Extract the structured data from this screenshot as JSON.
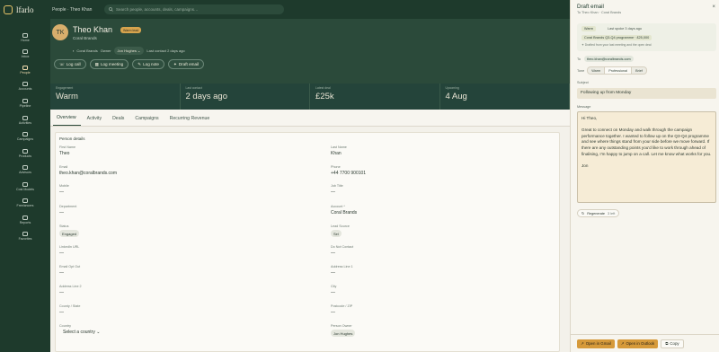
{
  "app": {
    "name": "lfarlo"
  },
  "breadcrumb": {
    "text": "People · Theo Khan"
  },
  "search": {
    "placeholder": "Search people, accounts, deals, campaigns…"
  },
  "sidebar": {
    "items": [
      {
        "label": "Home",
        "icon": "home-icon"
      },
      {
        "label": "Inbox",
        "icon": "inbox-icon"
      },
      {
        "label": "People",
        "icon": "people-icon",
        "active": true
      },
      {
        "label": "Accounts",
        "icon": "accounts-icon"
      },
      {
        "label": "Pipeline",
        "icon": "pipeline-icon"
      },
      {
        "label": "Activities",
        "icon": "activities-icon"
      },
      {
        "label": "Campaigns",
        "icon": "campaigns-icon"
      },
      {
        "label": "Products",
        "icon": "products-icon"
      },
      {
        "label": "Advisors",
        "icon": "advisors-icon"
      },
      {
        "label": "Cost Models",
        "icon": "cost-models-icon"
      },
      {
        "label": "Freelancers",
        "icon": "freelancers-icon"
      },
      {
        "label": "Reports",
        "icon": "reports-icon"
      },
      {
        "label": "Favorites",
        "icon": "favorites-icon"
      }
    ]
  },
  "contact": {
    "initials": "TK",
    "name": "Theo Khan",
    "badge": "Warm lead",
    "company": "Coral Brands",
    "meta_company": "Coral Brands",
    "owner_label": "Owner",
    "owner": "Jon Hughes",
    "last_contact": "Last contact 2 days ago"
  },
  "actions": [
    "Log call",
    "Log meeting",
    "Log note",
    "Draft email"
  ],
  "stats": [
    {
      "label": "Engagement",
      "value": "Warm"
    },
    {
      "label": "Last contact",
      "value": "2 days ago"
    },
    {
      "label": "Latest deal",
      "value": "£25k"
    },
    {
      "label": "Upcoming",
      "value": "4 Aug"
    }
  ],
  "tabs": [
    "Overview",
    "Activity",
    "Deals",
    "Campaigns",
    "Recurring Revenue"
  ],
  "details": {
    "title": "Person details",
    "fields": [
      {
        "label": "First Name",
        "value": "Theo"
      },
      {
        "label": "Last Name",
        "value": "Khan"
      },
      {
        "label": "Email",
        "value": "theo.khan@coralbrands.com"
      },
      {
        "label": "Phone",
        "value": "+44 7700 900101"
      },
      {
        "label": "Mobile",
        "value": "—"
      },
      {
        "label": "Job Title",
        "value": "—"
      },
      {
        "label": "Department",
        "value": "—"
      },
      {
        "label": "Account *",
        "value": "Coral Brands"
      },
      {
        "label": "Status",
        "value": "Engaged"
      },
      {
        "label": "Lead Source",
        "value": "Sel"
      },
      {
        "label": "LinkedIn URL",
        "value": "—"
      },
      {
        "label": "Do Not Contact",
        "value": "—"
      },
      {
        "label": "Email Opt Out",
        "value": "—"
      },
      {
        "label": "Address Line 1",
        "value": "—"
      },
      {
        "label": "Address Line 2",
        "value": "—"
      },
      {
        "label": "City",
        "value": "—"
      },
      {
        "label": "County / State",
        "value": "—"
      },
      {
        "label": "Postcode / ZIP",
        "value": "—"
      },
      {
        "label": "Country",
        "value": "Select a country"
      },
      {
        "label": "Person Owner",
        "value": "Jon Hughes"
      }
    ]
  },
  "drawer": {
    "title": "Draft email",
    "subtitle": "To Theo Khan · Coral Brands",
    "close": "×",
    "context": {
      "tag": "Warm",
      "spoke": "Last spoke 3 days ago",
      "deal": "Coral Brands Q3-Q4 programme · £25,000",
      "note": "Drafted from your last meeting and the open deal"
    },
    "to_label": "To",
    "to_email": "theo.khan@coralbrands.com",
    "tone_label": "Tone",
    "tones": [
      "Warm",
      "Professional",
      "Brief"
    ],
    "tone_selected": "Professional",
    "subject_label": "Subject",
    "subject": "Following up from Monday",
    "message_label": "Message",
    "message": "Hi Theo,\n\nGreat to connect on Monday and walk through the campaign performance together. I wanted to follow up on the Q3-Q4 programme and see where things stand from your side before we move forward. If there are any outstanding points you'd like to work through ahead of finalising, I'm happy to jump on a call. Let me know what works for you.\n\nJon",
    "regenerate": "Regenerate",
    "regenerate_left": "3 left",
    "footer": {
      "gmail": "Open in Gmail",
      "outlook": "Open in Outlook",
      "copy": "Copy"
    }
  }
}
